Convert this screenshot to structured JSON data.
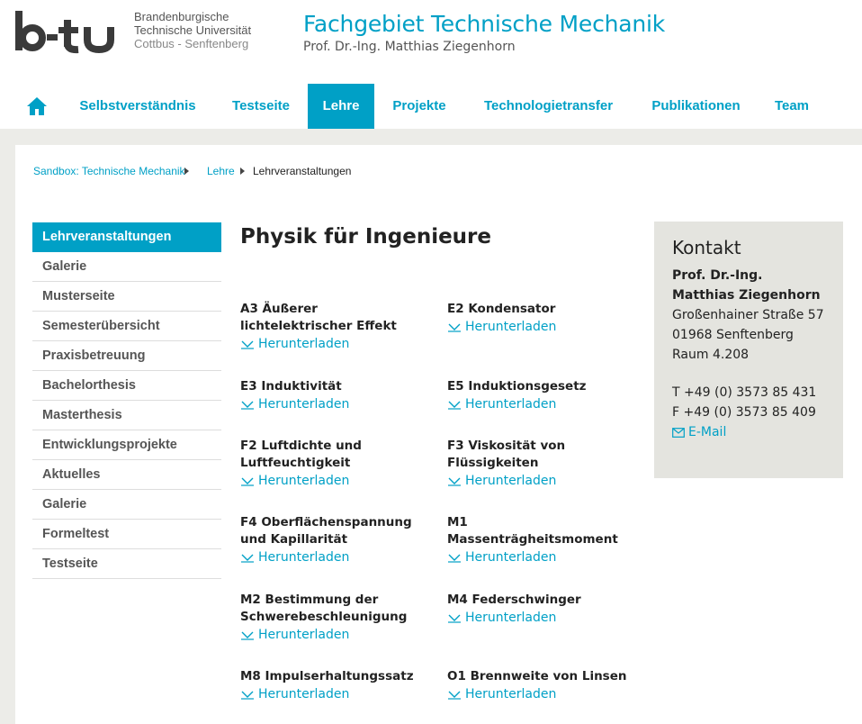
{
  "brand": {
    "logo_text": "b-tu",
    "university_lines": [
      "Brandenburgische",
      "Technische Universität",
      "Cottbus - Senftenberg"
    ]
  },
  "header": {
    "title": "Fachgebiet Technische Mechanik",
    "subtitle": "Prof. Dr.-Ing. Matthias Ziegenhorn"
  },
  "nav": {
    "home_icon": "home-icon",
    "items": [
      "Selbstverständnis",
      "Testseite",
      "Lehre",
      "Projekte",
      "Technologietransfer",
      "Publikationen",
      "Team"
    ],
    "active": "Lehre"
  },
  "breadcrumb": {
    "items": [
      "Sandbox: Technische Mechanik",
      "Lehre",
      "Lehrveranstaltungen"
    ]
  },
  "sidebar": {
    "items": [
      "Lehrveranstaltungen",
      "Galerie",
      "Musterseite",
      "Semesterübersicht",
      "Praxisbetreuung",
      "Bachelorthesis",
      "Masterthesis",
      "Entwicklungsprojekte",
      "Aktuelles",
      "Galerie",
      "Formeltest",
      "Testseite"
    ],
    "active": "Lehrveranstaltungen"
  },
  "main": {
    "title": "Physik für Ingenieure",
    "download_label": "Herunterladen",
    "experiments": [
      {
        "title": "A3 Äußerer lichtelektrischer Effekt"
      },
      {
        "title": "E2 Kondensator"
      },
      {
        "title": "E3 Induktivität"
      },
      {
        "title": "E5 Induktionsgesetz"
      },
      {
        "title": "F2 Luftdichte und Luftfeuchtigkeit"
      },
      {
        "title": "F3 Viskosität von Flüssigkeiten"
      },
      {
        "title": "F4 Oberflächenspannung und Kapillarität"
      },
      {
        "title": "M1 Massenträgheitsmoment"
      },
      {
        "title": "M2 Bestimmung der Schwerebeschleunigung"
      },
      {
        "title": "M4 Federschwinger"
      },
      {
        "title": "M8 Impulserhaltungssatz"
      },
      {
        "title": "O1 Brennweite von Linsen"
      }
    ]
  },
  "contact": {
    "title": "Kontakt",
    "name_line1": "Prof. Dr.-Ing.",
    "name_line2": "Matthias Ziegenhorn",
    "street": "Großenhainer Straße 57",
    "city": "01968 Senftenberg",
    "room": "Raum 4.208",
    "phone": "T +49 (0) 3573 85 431",
    "fax": "F +49 (0) 3573 85 409",
    "email_label": "E-Mail"
  },
  "colors": {
    "accent": "#00a0c6",
    "background": "#ecece8",
    "contact_bg": "#e4e4df"
  }
}
